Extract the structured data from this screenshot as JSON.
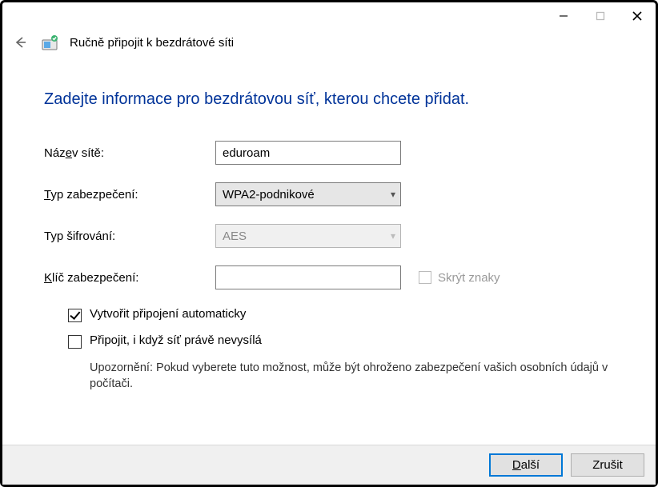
{
  "window": {
    "title": "Ručně připojit k bezdrátové síti"
  },
  "heading": "Zadejte informace pro bezdrátovou síť, kterou chcete přidat.",
  "labels": {
    "network_name_pre": "Náz",
    "network_name_ul": "e",
    "network_name_post": "v sítě:",
    "security_type_ul": "T",
    "security_type_post": "yp zabezpečení:",
    "encryption_type": "Typ šifrování:",
    "security_key_ul": "K",
    "security_key_post": "líč zabezpečení:",
    "hide_chars_ul": "S",
    "hide_chars_post": "krýt znaky",
    "auto_connect_ul": "V",
    "auto_connect_post": "ytvořit připojení automaticky",
    "connect_hidden_ul": "P",
    "connect_hidden_post": "řipojit, i když síť právě nevysílá",
    "warning": "Upozornění: Pokud vyberete tuto možnost, může být ohroženo zabezpečení vašich osobních údajů v počítači."
  },
  "values": {
    "network_name": "eduroam",
    "security_type": "WPA2-podnikové",
    "encryption_type": "AES",
    "security_key": "",
    "auto_connect_checked": true,
    "connect_hidden_checked": false,
    "hide_chars_checked": false
  },
  "buttons": {
    "next_ul": "D",
    "next_post": "alší",
    "cancel": "Zrušit"
  }
}
